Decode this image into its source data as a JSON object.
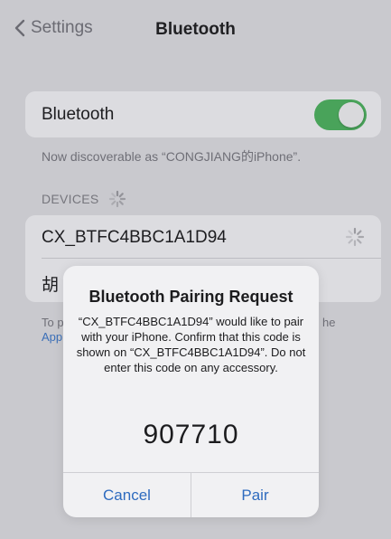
{
  "nav": {
    "back_label": "Settings",
    "title": "Bluetooth"
  },
  "bluetooth": {
    "label": "Bluetooth",
    "enabled": true,
    "discoverable_text": "Now discoverable as “CONGJIANG的iPhone”."
  },
  "devices": {
    "header": "DEVICES",
    "items": [
      {
        "name": "CX_BTFC4BBC1A1D94",
        "status": "connecting"
      },
      {
        "name": "胡"
      }
    ]
  },
  "footer": {
    "text_fragment": "To p",
    "link_fragment": "App",
    "trailing_fragment": "he"
  },
  "alert": {
    "title": "Bluetooth Pairing Request",
    "message": "“CX_BTFC4BBC1A1D94” would like to pair with your iPhone. Confirm that this code is shown on “CX_BTFC4BBC1A1D94”. Do not enter this code on any accessory.",
    "code": "907710",
    "cancel_label": "Cancel",
    "pair_label": "Pair"
  },
  "colors": {
    "accent": "#2e6bbf",
    "toggle_on": "#49a35a"
  },
  "icons": {
    "back": "chevron-left-icon",
    "spinner": "activity-spinner-icon"
  }
}
